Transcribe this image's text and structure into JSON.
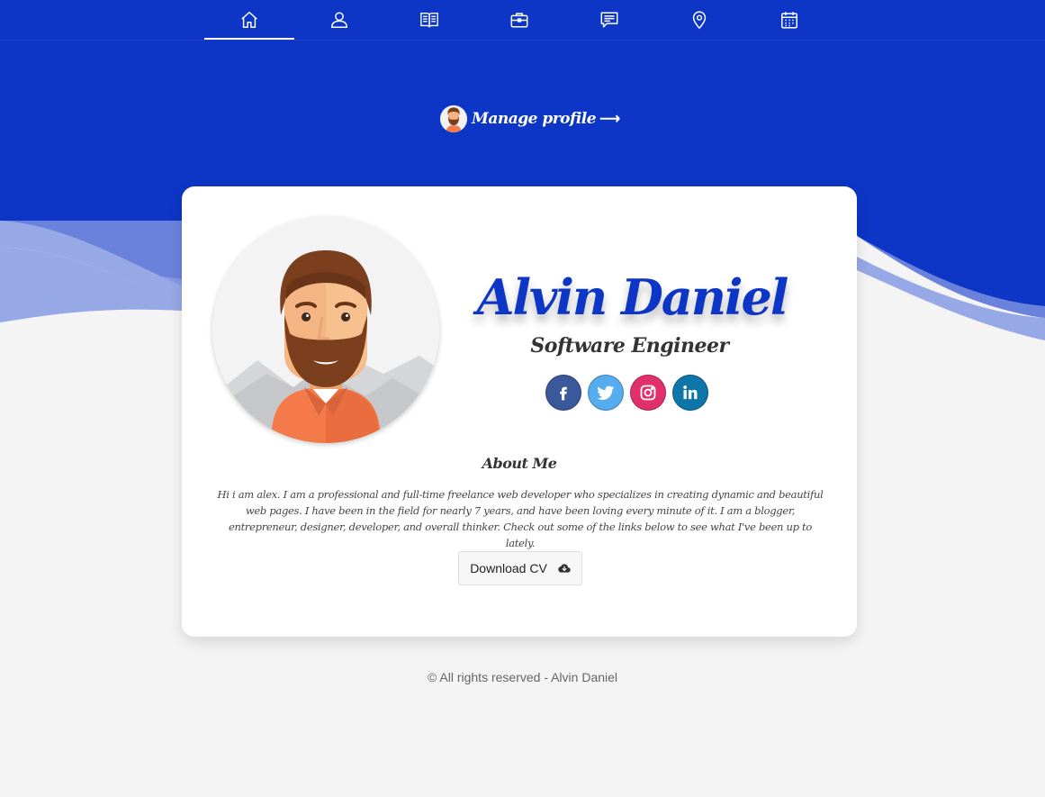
{
  "nav": {
    "items": [
      {
        "icon": "home-icon",
        "active": true
      },
      {
        "icon": "user-icon",
        "active": false
      },
      {
        "icon": "book-icon",
        "active": false
      },
      {
        "icon": "briefcase-icon",
        "active": false
      },
      {
        "icon": "message-icon",
        "active": false
      },
      {
        "icon": "location-pin-icon",
        "active": false
      },
      {
        "icon": "calendar-icon",
        "active": false
      }
    ]
  },
  "manage_profile": {
    "label": "Manage profile",
    "arrow": "⟶"
  },
  "profile": {
    "name": "Alvin Daniel",
    "title": "Software Engineer",
    "socials": [
      {
        "icon": "facebook-icon",
        "glyph": "f",
        "color": "#3b5998"
      },
      {
        "icon": "twitter-icon",
        "glyph": "t",
        "color": "#55acee"
      },
      {
        "icon": "instagram-icon",
        "glyph": "ig",
        "color": "#e1306c"
      },
      {
        "icon": "linkedin-icon",
        "glyph": "in",
        "color": "#0e76a8"
      }
    ]
  },
  "about": {
    "heading": "About Me",
    "text": "Hi i am alex. I am a professional and full-time freelance web developer who specializes in creating dynamic and beautiful web pages. I have been in the field for nearly 7 years, and have been loving every minute of it. I am a blogger, entrepreneur, designer, developer, and overall thinker. Check out some of the links below to see what I've been up to lately."
  },
  "download_cv": {
    "label": "Download CV",
    "icon": "cloud-download-icon"
  },
  "footer": {
    "text": "© All rights reserved - Alvin Daniel"
  },
  "colors": {
    "accent": "#0d36c6",
    "background": "#f4f4f4"
  }
}
